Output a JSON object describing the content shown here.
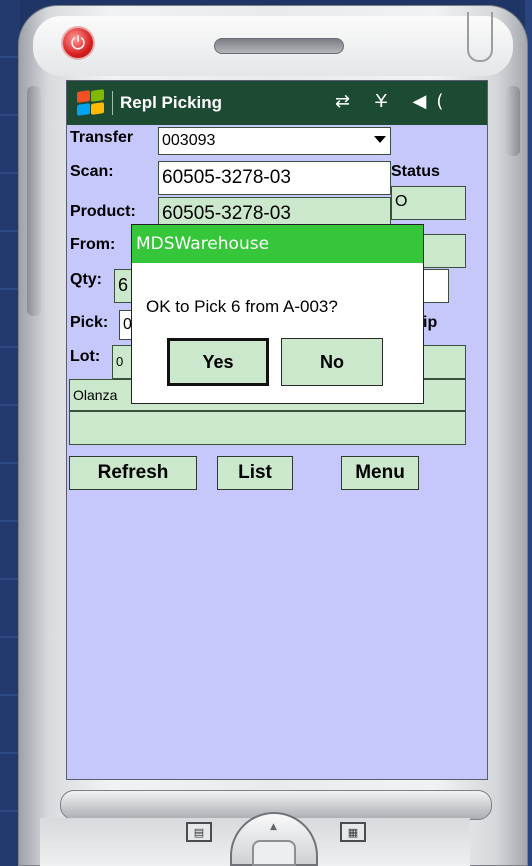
{
  "app": {
    "title": "Repl Picking",
    "status_icons": "⇄ Y̶ ◀("
  },
  "form": {
    "transfer_label": "Transfer",
    "transfer_value": "003093",
    "scan_label": "Scan:",
    "scan_value": "60505-3278-03",
    "status_label": "Status",
    "status_value": "O",
    "product_label": "Product:",
    "product_value": "60505-3278-03",
    "from_label": "From:",
    "qty_label": "Qty:",
    "qty_value": "6",
    "pick_label": "Pick:",
    "pick_value": "0",
    "skip_label_partial": "ip",
    "lot_label": "Lot:",
    "lot_value": "0",
    "description_value": "Olanza"
  },
  "buttons": {
    "refresh": "Refresh",
    "list": "List",
    "menu": "Menu"
  },
  "dialog": {
    "title": "MDSWarehouse",
    "message": "OK to Pick 6 from A-003?",
    "yes": "Yes",
    "no": "No"
  },
  "icons": {
    "power": "power-icon",
    "windows_flag": "windows-start-icon",
    "dropdown": "chevron-down-icon",
    "softkey_left": "softkey-left-icon",
    "softkey_right": "softkey-right-icon"
  },
  "colors": {
    "titlebar": "#1d4a32",
    "screen_bg": "#c6c8fb",
    "field_bg": "#cbe8cc",
    "dialog_title": "#35c63a"
  }
}
